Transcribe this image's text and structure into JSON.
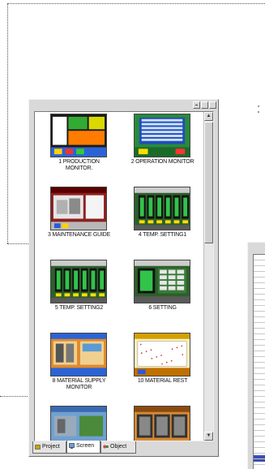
{
  "workspace": {
    "tabs": [
      {
        "label": "Project",
        "icon": "project-icon",
        "active": false
      },
      {
        "label": "Screen",
        "icon": "screen-icon",
        "active": true
      },
      {
        "label": "Object",
        "icon": "object-icon",
        "active": false
      }
    ],
    "screens": [
      {
        "label": "1 PRODUCTION\nMONITOR.",
        "theme": "production"
      },
      {
        "label": "2 OPERATION MONITOR",
        "theme": "operation"
      },
      {
        "label": "3 MAINTENANCE GUIDE",
        "theme": "maintenance"
      },
      {
        "label": "4 TEMP. SETTING1",
        "theme": "temp"
      },
      {
        "label": "5 TEMP. SETTING2",
        "theme": "temp"
      },
      {
        "label": "6 SETTING",
        "theme": "setting"
      },
      {
        "label": "8 MATERIAL SUPPLY\nMONITOR",
        "theme": "supply"
      },
      {
        "label": "10 MATERIAL REST",
        "theme": "rest"
      },
      {
        "label": "",
        "theme": "supply2"
      },
      {
        "label": "",
        "theme": "supply3"
      }
    ]
  },
  "colors": {
    "window_bg": "#d9d9d9",
    "panel_bg": "#ffffff",
    "selection": "#3a4fb0"
  }
}
